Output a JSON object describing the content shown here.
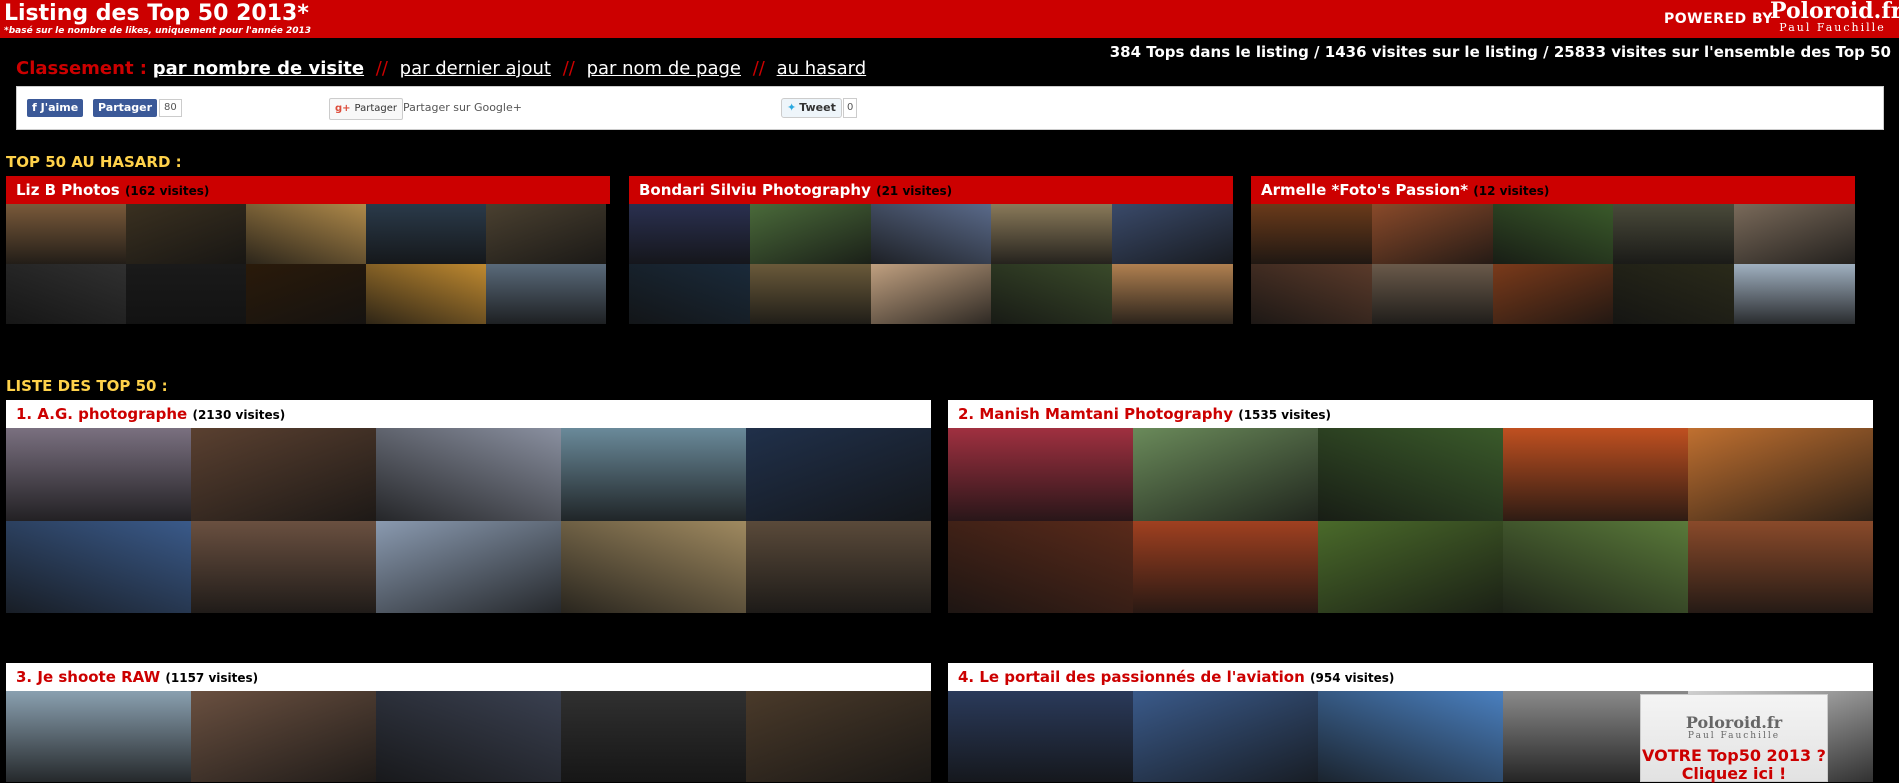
{
  "header": {
    "title": "Listing des Top 50 2013*",
    "subtitle": "*basé sur le nombre de likes, uniquement pour l'année 2013",
    "powered_by": "POWERED BY",
    "logo_main": "Poloroid.fr",
    "logo_sub": "Paul Fauchille"
  },
  "stats": "384 Tops dans le listing / 1436 visites sur le listing / 25833 visites sur l'ensemble des Top 50",
  "sort": {
    "label": "Classement :",
    "options": [
      "par nombre de visite",
      "par dernier ajout",
      "par nom de page",
      "au hasard"
    ],
    "separator": "//"
  },
  "social": {
    "fb_like": "J'aime",
    "fb_share": "Partager",
    "fb_count": "80",
    "gplus_label": "Partager",
    "gplus_text": "Partager sur Google+",
    "tweet_label": "Tweet",
    "tweet_count": "0"
  },
  "random_section": {
    "title": "TOP 50 AU HASARD :",
    "cards": [
      {
        "name": "Liz B Photos",
        "visits": "(162 visites)"
      },
      {
        "name": "Bondari Silviu Photography",
        "visits": "(21 visites)"
      },
      {
        "name": "Armelle *Foto's Passion*",
        "visits": "(12 visites)"
      }
    ]
  },
  "list_section": {
    "title": "LISTE DES TOP 50 :",
    "cards": [
      {
        "name": "1. A.G. photographe",
        "visits": "(2130 visites)"
      },
      {
        "name": "2. Manish Mamtani Photography",
        "visits": "(1535 visites)"
      },
      {
        "name": "3. Je shoote RAW",
        "visits": "(1157 visites)"
      },
      {
        "name": "4. Le portail des passionnés de l'aviation",
        "visits": "(954 visites)"
      }
    ]
  },
  "promo": {
    "logo": "Poloroid.fr",
    "logo_sub": "Paul Fauchille",
    "line1": "VOTRE Top50 2013 ?",
    "line2": "Cliquez ici !"
  },
  "thumb_palettes": {
    "liz": [
      "#7a5a3a",
      "#3a3020",
      "#b08a4a",
      "#2a3a4a",
      "#4a4030",
      "#303030",
      "#1a1a1a",
      "#2a1a0a",
      "#c08a30",
      "#5a6a7a"
    ],
    "bondari": [
      "#2a3050",
      "#4a6a3a",
      "#5a6a8a",
      "#8a7a5a",
      "#3a4a6a",
      "#1a2a3a",
      "#6a5a3a",
      "#c0a080",
      "#3a4a2a",
      "#b08050"
    ],
    "armelle": [
      "#6a3a1a",
      "#8a4a2a",
      "#3a5a2a",
      "#4a4a3a",
      "#7a6a5a",
      "#5a3a2a",
      "#6a5a4a",
      "#7a3a1a",
      "#2a2a1a",
      "#a0b0c0"
    ],
    "ag": [
      "#7a7080",
      "#5a4030",
      "#8a90a0",
      "#6a8a9a",
      "#20304a",
      "#3a5a8a",
      "#6a5040",
      "#8a9ab0",
      "#a08a60",
      "#5a4a3a"
    ],
    "manish": [
      "#a03040",
      "#6a8a5a",
      "#3a5a2a",
      "#c05020",
      "#c07030",
      "#5a2a1a",
      "#a04020",
      "#4a6a2a",
      "#5a7a3a",
      "#8a4a2a"
    ],
    "raw": [
      "#8aa0b0",
      "#6a5040",
      "#3a4050",
      "#303030",
      "#4a3a2a"
    ],
    "aviation": [
      "#2a3a5a",
      "#3a5a8a",
      "#4a80c0",
      "#8a8a8a",
      "#d0d0d0"
    ]
  }
}
